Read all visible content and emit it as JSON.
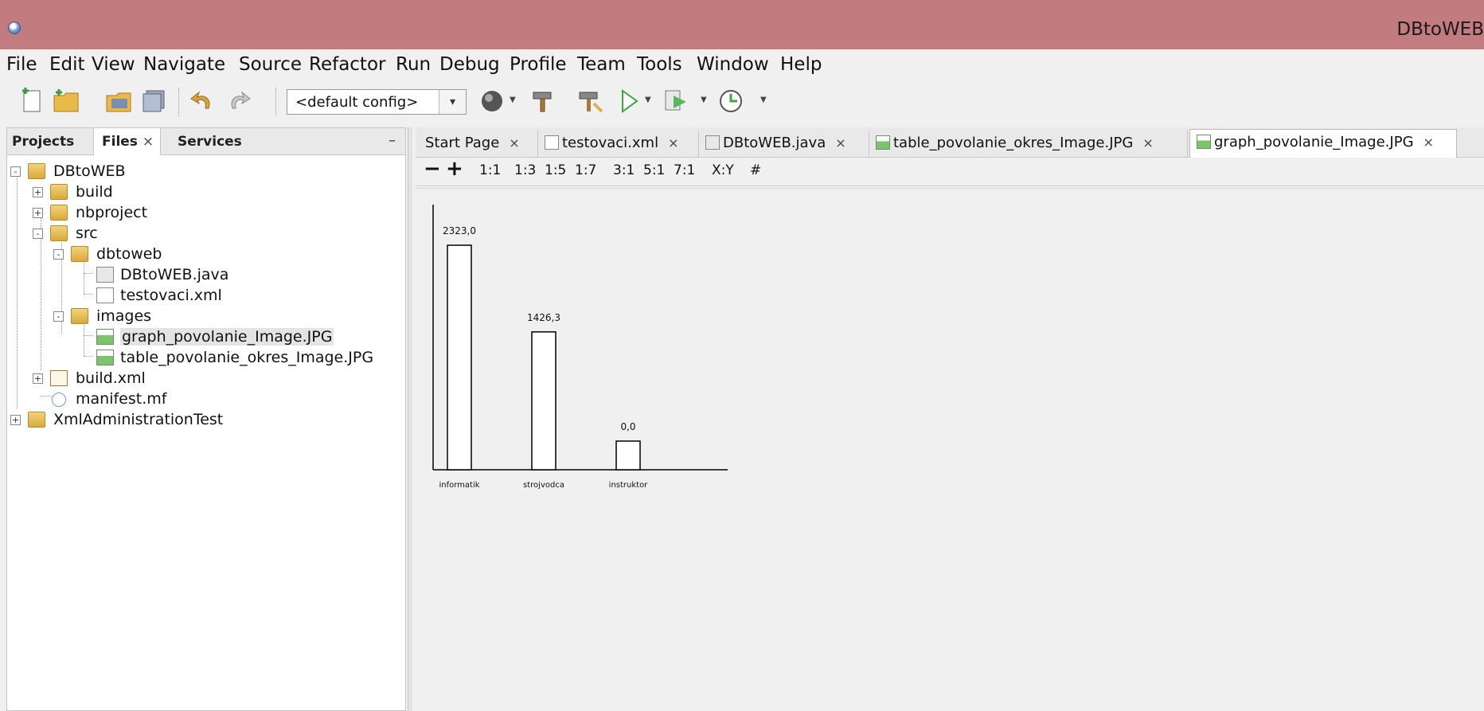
{
  "window": {
    "title": "DBtoWEB"
  },
  "menu": [
    "File",
    "Edit",
    "View",
    "Navigate",
    "Source",
    "Refactor",
    "Run",
    "Debug",
    "Profile",
    "Team",
    "Tools",
    "Window",
    "Help"
  ],
  "toolbar": {
    "config_value": "<default config>",
    "icons": [
      "new-file-icon",
      "new-project-icon",
      "open-project-icon",
      "save-all-icon",
      "undo-icon",
      "redo-icon",
      "globe-icon",
      "build-hammer-icon",
      "clean-build-icon",
      "run-icon",
      "debug-icon",
      "profile-icon"
    ]
  },
  "projects_panel": {
    "tabs": [
      {
        "label": "Projects",
        "active": false
      },
      {
        "label": "Files",
        "active": true,
        "close": "×"
      },
      {
        "label": "Services",
        "active": false
      }
    ],
    "minimize": "–",
    "tree": [
      {
        "label": "DBtoWEB",
        "type": "folder",
        "expander": "-"
      },
      {
        "label": "build",
        "type": "folder",
        "expander": "+"
      },
      {
        "label": "nbproject",
        "type": "folder",
        "expander": "+"
      },
      {
        "label": "src",
        "type": "folder",
        "expander": "-"
      },
      {
        "label": "dbtoweb",
        "type": "folder",
        "expander": "-"
      },
      {
        "label": "DBtoWEB.java",
        "type": "java"
      },
      {
        "label": "testovaci.xml",
        "type": "xml"
      },
      {
        "label": "images",
        "type": "folder",
        "expander": "-"
      },
      {
        "label": "graph_povolanie_Image.JPG",
        "type": "image",
        "selected": true
      },
      {
        "label": "table_povolanie_okres_Image.JPG",
        "type": "image"
      },
      {
        "label": "build.xml",
        "type": "ant",
        "expander": "+"
      },
      {
        "label": "manifest.mf",
        "type": "manifest"
      },
      {
        "label": "XmlAdministrationTest",
        "type": "folder",
        "expander": "+"
      }
    ]
  },
  "editor": {
    "tabs": [
      {
        "label": "Start Page",
        "icon": "",
        "active": false
      },
      {
        "label": "testovaci.xml",
        "icon": "xml-file-icon",
        "active": false
      },
      {
        "label": "DBtoWEB.java",
        "icon": "java-file-icon",
        "active": false
      },
      {
        "label": "table_povolanie_okres_Image.JPG",
        "icon": "image-file-icon",
        "active": false
      },
      {
        "label": "graph_povolanie_Image.JPG",
        "icon": "image-file-icon",
        "active": true
      }
    ],
    "close_glyph": "×",
    "zoom_toolbar": {
      "zoom_out": "−",
      "zoom_in": "+",
      "ratios": [
        "1:1",
        "1:3",
        "1:5",
        "1:7",
        "3:1",
        "5:1",
        "7:1",
        "X:Y",
        "#"
      ]
    }
  },
  "chart_data": {
    "type": "bar",
    "categories": [
      "informatik",
      "strojvodca",
      "instruktor"
    ],
    "values": [
      2323.0,
      1426.3,
      0.0
    ],
    "value_labels": [
      "2323,0",
      "1426,3",
      "0,0"
    ],
    "title": "",
    "xlabel": "",
    "ylabel": "",
    "grid": false,
    "legend": "none"
  }
}
